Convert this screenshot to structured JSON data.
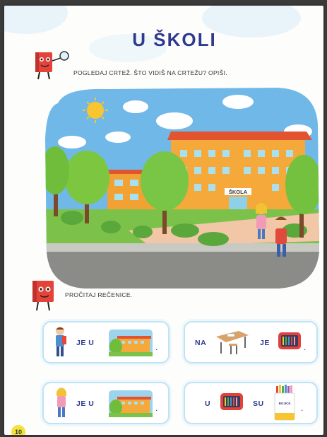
{
  "page": {
    "title": "U ŠKOLI",
    "page_number": "10"
  },
  "task1": {
    "instruction": "POGLEDAJ CRTEŽ. ŠTO VIDIŠ NA CRTEŽU? OPIŠI."
  },
  "scene": {
    "school_sign": "ŠKOLA"
  },
  "task2": {
    "instruction": "PROČITAJ REČENICE.",
    "sentences": [
      {
        "w1": "JE U",
        "end": "."
      },
      {
        "w1": "NA",
        "w2": "JE",
        "end": "."
      },
      {
        "w1": "JE U",
        "end": "."
      },
      {
        "w1": "U",
        "w2": "SU",
        "end": "."
      }
    ],
    "crayon_box_label": "BOJICE"
  },
  "colors": {
    "title": "#2f3a8f",
    "accent_yellow": "#f2e23a",
    "card_border": "#bfe3f3"
  }
}
